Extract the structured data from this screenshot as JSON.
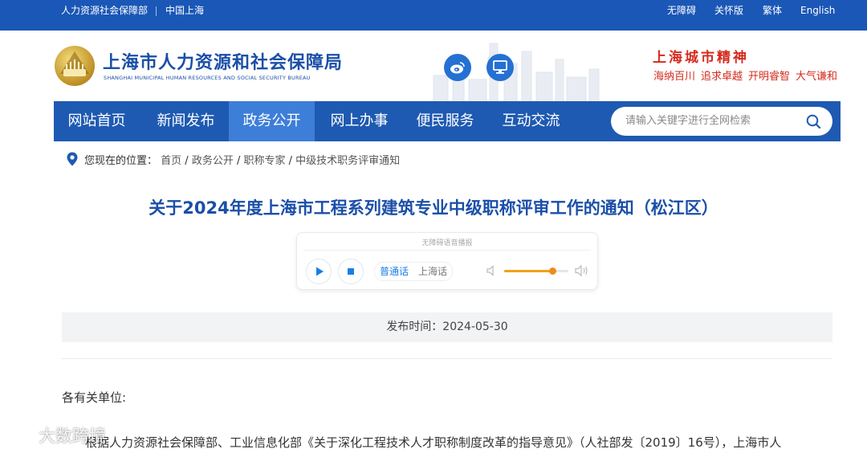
{
  "topbar": {
    "left_links": [
      "人力资源社会保障部",
      "中国上海"
    ],
    "right_links": [
      "无障碍",
      "关怀版",
      "繁体",
      "English"
    ]
  },
  "header": {
    "site_name": "上海市人力资源和社会保障局",
    "site_name_en": "SHANGHAI MUNICIPAL HUMAN RESOURCES AND SOCIAL SECURITY BUREAU",
    "slogan_title": "上海城市精神",
    "slogan_words": [
      "海纳百川",
      "追求卓越",
      "开明睿智",
      "大气谦和"
    ],
    "icons": [
      "weibo-icon",
      "monitor-icon"
    ]
  },
  "nav": {
    "items": [
      "网站首页",
      "新闻发布",
      "政务公开",
      "网上办事",
      "便民服务",
      "互动交流"
    ],
    "active_index": 2,
    "search_placeholder": "请输入关键字进行全网检索"
  },
  "breadcrumb": {
    "label": "您现在的位置：",
    "items": [
      "首页",
      "政务公开",
      "职称专家",
      "中级技术职务评审通知"
    ]
  },
  "article": {
    "title": "关于2024年度上海市工程系列建筑专业中级职称评审工作的通知（松江区）",
    "date_label": "发布时间：2024-05-30",
    "greeting": "各有关单位:",
    "first_paragraph": "根据人力资源社会保障部、工业信息化部《关于深化工程技术人才职称制度改革的指导意见》（人社部发〔2019〕16号），上海市人"
  },
  "player": {
    "caption": "无障碍语音播报",
    "lang_options": [
      "普通话",
      "上海话"
    ],
    "selected_lang": "普通话",
    "volume_fraction": 0.75
  },
  "watermark": "大数跨境",
  "colors": {
    "brand_blue": "#1b57b6",
    "nav_blue": "#1e5ab2",
    "nav_active": "#3d7ed8",
    "title_blue": "#1b4fa8",
    "slogan_red": "#d42b1e",
    "accent_orange": "#f08a1a"
  }
}
